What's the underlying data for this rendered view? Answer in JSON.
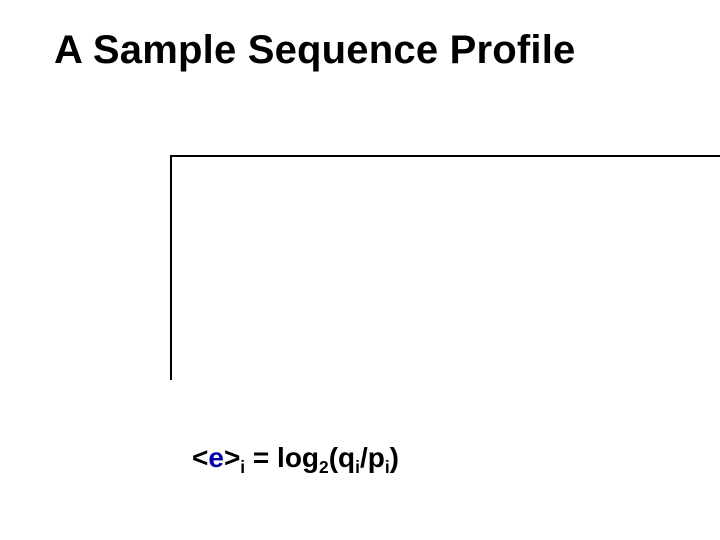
{
  "title": "A Sample Sequence Profile",
  "formula": {
    "open_angle": "<",
    "epsilon": "e",
    "close_angle": ">",
    "sub_i_1": "i",
    "equals_log": " = log",
    "sub_2": "2",
    "open_paren_q": "(q",
    "sub_i_2": "i",
    "slash_p": "/p",
    "sub_i_3": "i",
    "close_paren": ")"
  }
}
